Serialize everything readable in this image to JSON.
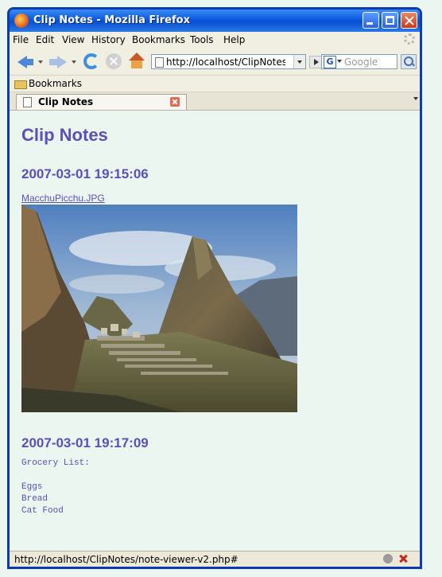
{
  "window": {
    "title": "Clip Notes - Mozilla Firefox"
  },
  "menu": [
    "File",
    "Edit",
    "View",
    "History",
    "Bookmarks",
    "Tools",
    "Help"
  ],
  "navbar": {
    "url": "http://localhost/ClipNotes/r",
    "search_placeholder": "Google"
  },
  "bookmarks": {
    "label": "Bookmarks"
  },
  "tab": {
    "label": "Clip Notes"
  },
  "page": {
    "heading": "Clip Notes",
    "entries": [
      {
        "timestamp": "2007-03-01 19:15:06",
        "link": "MacchuPicchu.JPG"
      },
      {
        "timestamp": "2007-03-01 19:17:09",
        "note": "Grocery List:\n\nEggs\nBread\nCat Food"
      }
    ],
    "text_color": "#5a50b8",
    "background": "#eaf6ef"
  },
  "status": {
    "text": "http://localhost/ClipNotes/note-viewer-v2.php#"
  }
}
